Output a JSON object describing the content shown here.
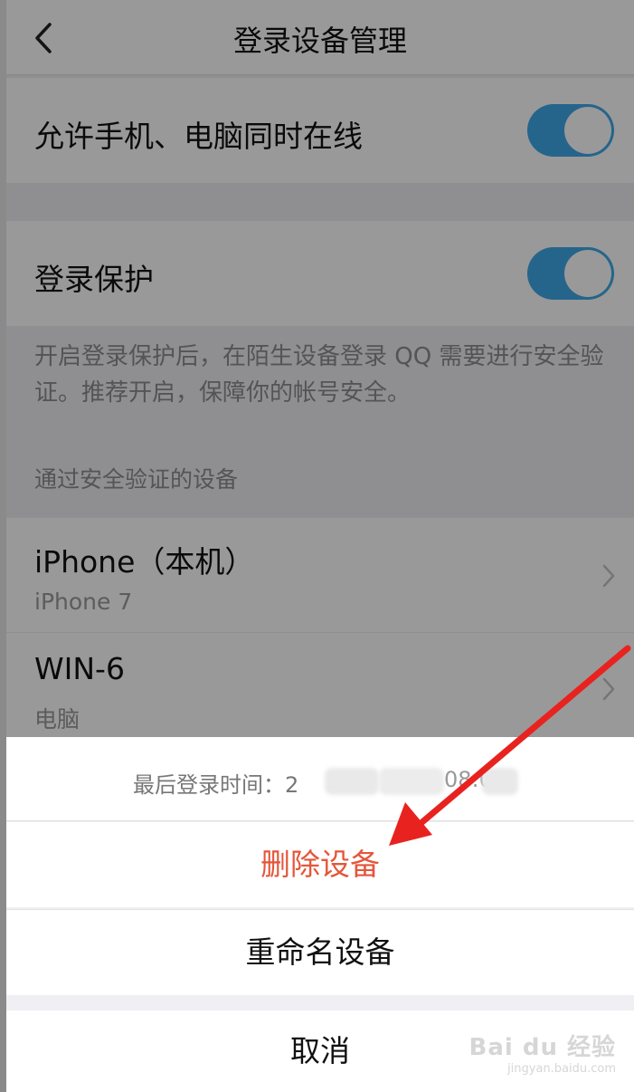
{
  "nav": {
    "title": "登录设备管理"
  },
  "settings": {
    "multi_online_label": "允许手机、电脑同时在线",
    "login_protect_label": "登录保护",
    "login_protect_desc": "开启登录保护后，在陌生设备登录 QQ 需要进行安全验证。推荐开启，保障你的帐号安全。"
  },
  "devices": {
    "section_title": "通过安全验证的设备",
    "items": [
      {
        "name": "iPhone（本机）",
        "type": "iPhone 7"
      },
      {
        "name": "WIN-6",
        "type": "电脑"
      }
    ]
  },
  "sheet": {
    "last_login_label": "最后登录时间：",
    "last_login_value_visible": "2",
    "last_login_value_tail": "08:0",
    "delete_label": "删除设备",
    "rename_label": "重命名设备",
    "cancel_label": "取消"
  },
  "watermark": {
    "main": "Bai du 经验",
    "sub": "jingyan.baidu.com"
  },
  "colors": {
    "toggle_on": "#3fa9e8",
    "destructive": "#e4563a",
    "annotation_arrow": "#e8231f"
  }
}
